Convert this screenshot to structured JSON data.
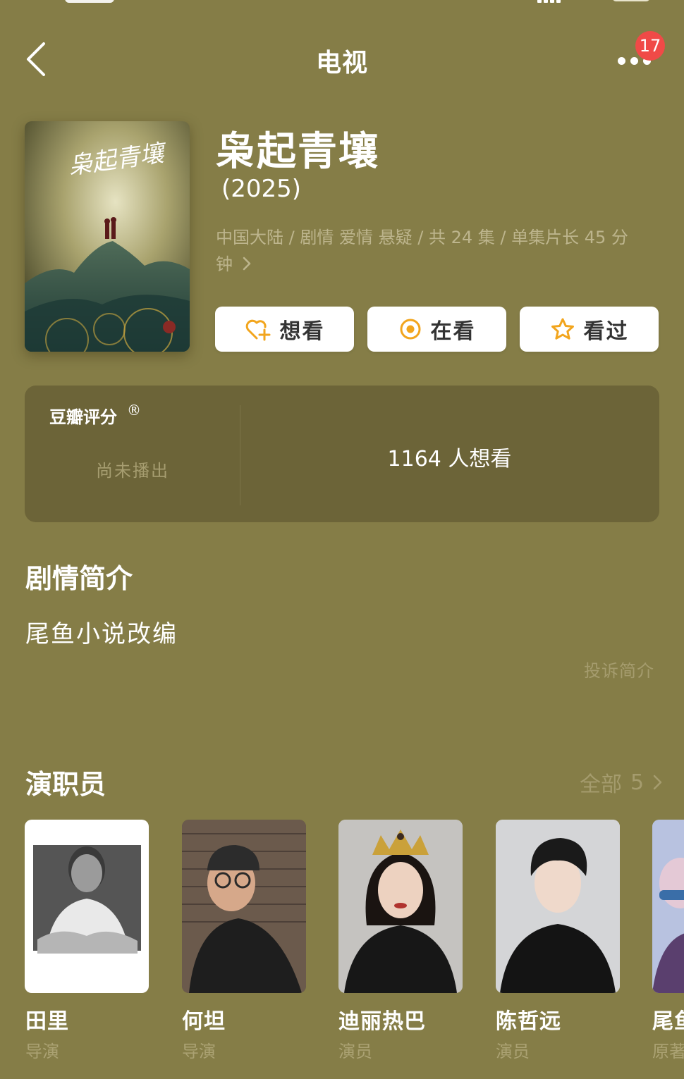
{
  "nav": {
    "title": "电视",
    "notification_count": "17"
  },
  "movie": {
    "title": "枭起青壤",
    "year": "(2025)",
    "meta": "中国大陆 / 剧情 爱情 悬疑 / 共 24 集 / 单集片长 45 分",
    "meta_more": "钟",
    "poster_calligraphy": "枭起青壤"
  },
  "actions": [
    {
      "label": "想看",
      "icon": "heart-plus-icon"
    },
    {
      "label": "在看",
      "icon": "target-icon"
    },
    {
      "label": "看过",
      "icon": "star-icon"
    }
  ],
  "rating": {
    "title": "豆瓣评分",
    "registered": "®",
    "status": "尚未播出",
    "want_count": "1164 人想看"
  },
  "synopsis": {
    "heading": "剧情简介",
    "text": "尾鱼小说改编",
    "report": "投诉简介"
  },
  "cast_section": {
    "heading": "演职员",
    "all_label": "全部",
    "all_count": "5"
  },
  "cast": [
    {
      "name": "田里",
      "role": "导演"
    },
    {
      "name": "何坦",
      "role": "导演"
    },
    {
      "name": "迪丽热巴",
      "role": "演员"
    },
    {
      "name": "陈哲远",
      "role": "演员"
    },
    {
      "name": "尾鱼",
      "role": "原著"
    }
  ],
  "colors": {
    "background": "#857d47",
    "card": "#6c6438",
    "muted_text": "#a59c6e",
    "accent_orange": "#f2a51d",
    "badge_red": "#f04a47"
  }
}
